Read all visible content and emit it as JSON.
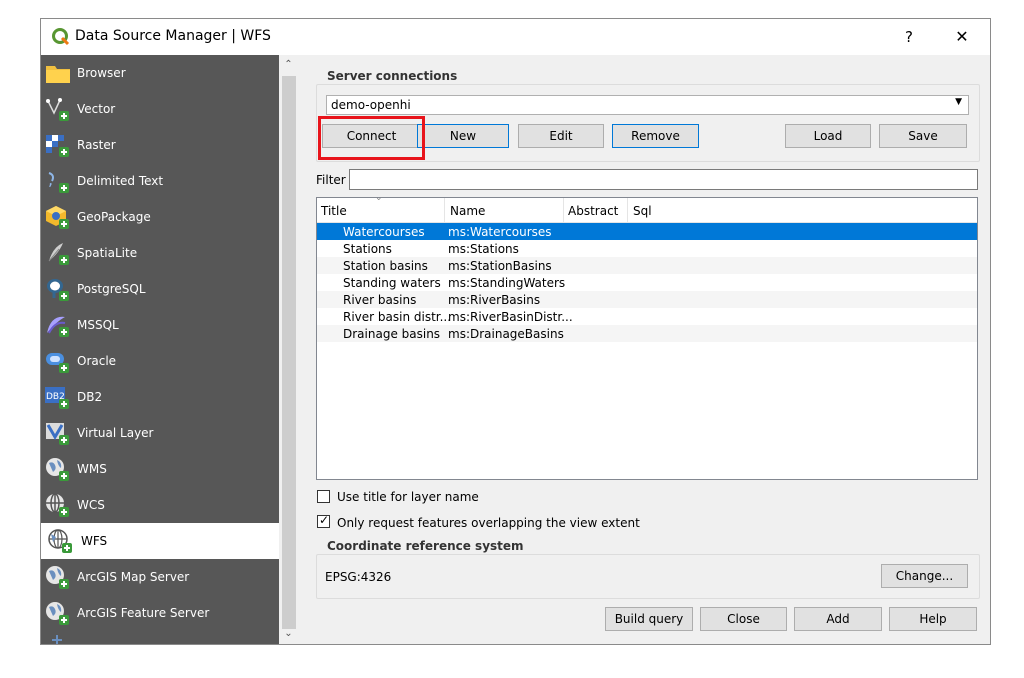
{
  "window": {
    "title": "Data Source Manager | WFS",
    "help_label": "?",
    "close_label": "✕"
  },
  "sidebar": {
    "items": [
      {
        "label": "Browser",
        "icon": "folder-icon"
      },
      {
        "label": "Vector",
        "icon": "vector-icon"
      },
      {
        "label": "Raster",
        "icon": "raster-icon"
      },
      {
        "label": "Delimited Text",
        "icon": "delimited-text-icon"
      },
      {
        "label": "GeoPackage",
        "icon": "geopackage-icon"
      },
      {
        "label": "SpatiaLite",
        "icon": "spatialite-icon"
      },
      {
        "label": "PostgreSQL",
        "icon": "postgresql-icon"
      },
      {
        "label": "MSSQL",
        "icon": "mssql-icon"
      },
      {
        "label": "Oracle",
        "icon": "oracle-icon"
      },
      {
        "label": "DB2",
        "icon": "db2-icon"
      },
      {
        "label": "Virtual Layer",
        "icon": "virtual-layer-icon"
      },
      {
        "label": "WMS",
        "icon": "wms-icon"
      },
      {
        "label": "WCS",
        "icon": "wcs-icon"
      },
      {
        "label": "WFS",
        "icon": "wfs-icon"
      },
      {
        "label": "ArcGIS Map Server",
        "icon": "arcgis-map-server-icon"
      },
      {
        "label": "ArcGIS Feature Server",
        "icon": "arcgis-feature-server-icon"
      }
    ],
    "active": "WFS",
    "db2_badge": "DB2"
  },
  "server": {
    "group_title": "Server connections",
    "selected_connection": "demo-openhi",
    "buttons": {
      "connect": "Connect",
      "new": "New",
      "edit": "Edit",
      "remove": "Remove",
      "load": "Load",
      "save": "Save"
    }
  },
  "filter": {
    "label": "Filter",
    "value": ""
  },
  "table": {
    "columns": [
      "Title",
      "Name",
      "Abstract",
      "Sql"
    ],
    "rows": [
      {
        "title": "Watercourses",
        "name": "ms:Watercourses"
      },
      {
        "title": "Stations",
        "name": "ms:Stations"
      },
      {
        "title": "Station basins",
        "name": "ms:StationBasins"
      },
      {
        "title": "Standing waters",
        "name": "ms:StandingWaters"
      },
      {
        "title": "River basins",
        "name": "ms:RiverBasins"
      },
      {
        "title": "River basin distr...",
        "name": "ms:RiverBasinDistr..."
      },
      {
        "title": "Drainage basins",
        "name": "ms:DrainageBasins"
      }
    ],
    "selected_row": 0
  },
  "options": {
    "use_title": {
      "label": "Use title for layer name",
      "checked": false
    },
    "only_request": {
      "label": "Only request features overlapping the view extent",
      "checked": true
    }
  },
  "crs": {
    "group_title": "Coordinate reference system",
    "value": "EPSG:4326",
    "change_label": "Change..."
  },
  "footer": {
    "build_query": "Build query",
    "close": "Close",
    "add": "Add",
    "help": "Help"
  },
  "colors": {
    "selection": "#0078d7",
    "highlight": "#e8141b",
    "sidebar": "#575757"
  }
}
